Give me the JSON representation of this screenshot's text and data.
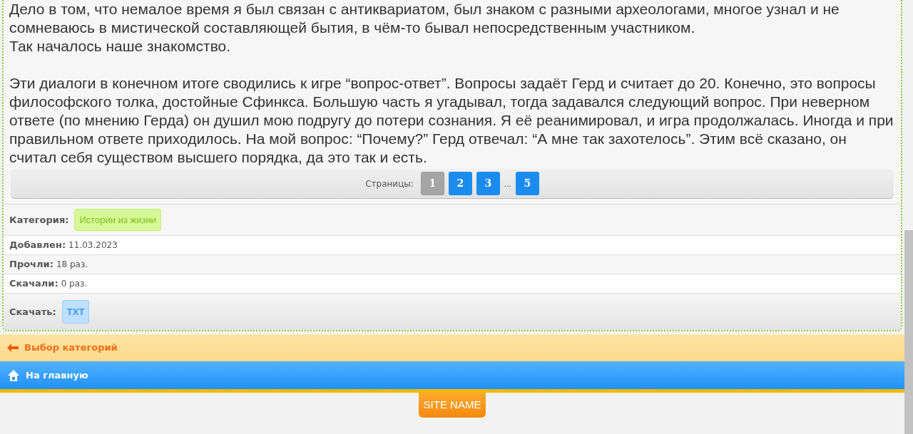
{
  "article": {
    "paragraphs": [
      [
        "Дело в том, что немалое время я был связан с антиквариатом, был знаком с разными археологами, многое узнал и не сомневаюсь в мистической составляющей бытия, в чём-то бывал непосредственным участником.",
        "Так началось наше знакомство."
      ],
      [
        "Эти диалоги в конечном итоге сводились к игре “вопрос-ответ”. Вопросы задаёт Герд и считает до 20. Конечно, это вопросы философского толка, достойные Сфинкса. Большую часть я угадывал, тогда задавался следующий вопрос. При неверном ответе (по мнению Герда) он душил мою подругу до потери сознания. Я её реанимировал, и игра продолжалась. Иногда и при правильном ответе приходилось. На мой вопрос: “Почему?” Герд отвечал: “А мне так захотелось”. Этим всё сказано, он считал себя существом высшего порядка, да это так и есть."
      ]
    ]
  },
  "pagination": {
    "label": "Страницы:",
    "items": [
      {
        "kind": "page",
        "text": "1",
        "selected": true
      },
      {
        "kind": "page",
        "text": "2",
        "selected": false
      },
      {
        "kind": "page",
        "text": "3",
        "selected": false
      },
      {
        "kind": "gap",
        "text": "..."
      },
      {
        "kind": "page",
        "text": "5",
        "selected": false
      }
    ]
  },
  "info_rows": [
    {
      "kind": "tag",
      "label": "Категория:",
      "value": "Истории из жизни"
    },
    {
      "kind": "text",
      "label": "Добавлен:",
      "value": "11.03.2023"
    },
    {
      "kind": "text",
      "label": "Прочли:",
      "value": "18 раз."
    },
    {
      "kind": "text",
      "label": "Скачали:",
      "value": "0 раз."
    },
    {
      "kind": "download",
      "label": "Скачать:",
      "value": "TXT"
    }
  ],
  "nav": [
    {
      "kind": "back",
      "label": "Выбор категорий"
    },
    {
      "kind": "home",
      "label": "На главную"
    }
  ],
  "footer": {
    "site_name": "SITE NAME"
  }
}
